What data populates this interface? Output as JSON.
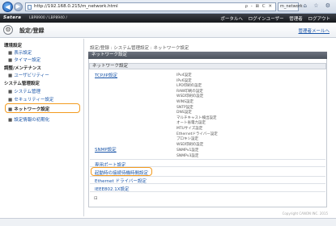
{
  "browser": {
    "back_icon": "◀",
    "forward_icon": "▶",
    "url": "http://192.168.0.215/m_network.html",
    "addr_controls": "ρ - ⊠ C ✕",
    "tab_label": "m_network",
    "window_icons": "⌂ ☆ ⚙"
  },
  "header": {
    "brand": "Satera",
    "device": "LBP8900 / LBP8940 /",
    "portal_link": "ポータルへ",
    "user": "ログインユーザー",
    "admin": "管理者",
    "logout": "ログアウト"
  },
  "title": {
    "icon": "⚙",
    "text": "設定/登録",
    "top_link": "管理者メールへ"
  },
  "sidebar": {
    "head_preferences": "環境設定",
    "items_pref": [
      {
        "bullet": "■",
        "label": "表示設定"
      },
      {
        "bullet": "■",
        "label": "タイマー設定"
      }
    ],
    "head_maintenance": "調整/メンテナンス",
    "items_maint": [
      {
        "bullet": "■",
        "label": "ユーザビリティー"
      }
    ],
    "head_system": "システム管理設定",
    "items_system": [
      {
        "bullet": "■",
        "label": "システム管理"
      },
      {
        "bullet": "■",
        "label": "セキュリティー設定"
      },
      {
        "bullet": "■",
        "label": "ネットワーク設定"
      },
      {
        "bullet": "■",
        "label": "設定情報の初期化"
      }
    ]
  },
  "main": {
    "breadcrumb": "設定/登録 : システム管理設定 : ネットワーク設定",
    "section_title": "ネットワーク設定",
    "subsection": "ネットワーク設定",
    "tcpip_link": "TCP/IP設定",
    "tcpip_items": [
      "IPv4設定",
      "IPv6設定",
      "LPD印刷の設定",
      "RAW印刷の設定",
      "WSD印刷の設定",
      "WINS設定",
      "SNTP設定",
      "DNS設定",
      "マルチキャスト検出設定",
      "オート省電力設定",
      "MTUサイズ設定",
      "Ethernetドライバー設定",
      "プロキシ設定",
      "WSD印刷の設定"
    ],
    "snmp_link": "SNMP設定",
    "snmp_items": [
      "SNMPv1設定",
      "SNMPv3設定"
    ],
    "dedicated_port": "専用ポート設定",
    "wait_time": "起動時の接続待機時間設定",
    "ethernet_driver": "Ethernet ドライバー設定",
    "ieee_link": "IEEE802.1X設定",
    "copyright": "Copyright CANON INC. 2015"
  },
  "colors": {
    "accent_highlight": "#f39b1f",
    "link": "#1a55a8",
    "header_bar": "#15171b"
  }
}
